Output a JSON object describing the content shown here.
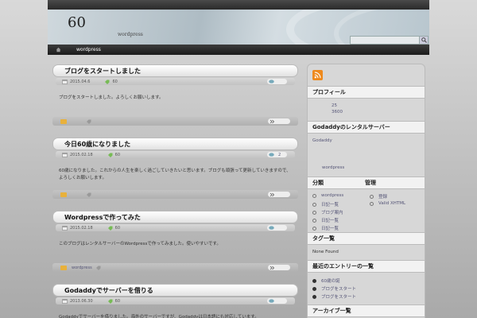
{
  "site": {
    "title": "60",
    "description": "wordpress"
  },
  "nav": {
    "items": [
      "wordpress"
    ]
  },
  "posts": [
    {
      "title": "ブログをスタートしました",
      "date": "2015.04.6",
      "tag": "60",
      "excerpt": "ブログをスタートしました。よろしくお願いします。",
      "comments": "",
      "category": ""
    },
    {
      "title": "今日60歳になりました",
      "date": "2015.02.18",
      "tag": "60",
      "excerpt": "60歳になりました。これからの人生を楽しく過ごしていきたいと思います。ブログも頑張って更新していきますので、よろしくお願いします。",
      "comments": "2",
      "category": ""
    },
    {
      "title": "Wordpressで作ってみた",
      "date": "2015.02.18",
      "tag": "60",
      "excerpt": "このブログはレンタルサーバーのWordpressで作ってみました。使いやすいです。",
      "comments": "",
      "category": "wordpress"
    },
    {
      "title": "Godaddyでサーバーを借りる",
      "date": "2013.06.30",
      "tag": "60",
      "excerpt": "Godaddyでサーバーを借りました。海外のサーバーですが、Godaddyは日本語にも対応しています。",
      "comments": "",
      "category": ""
    }
  ],
  "sidebar": {
    "profile": {
      "title": "プロフィール",
      "line1": "25",
      "line2": "3600"
    },
    "godaddy": {
      "title": "Godaddyのレンタルサーバー",
      "line1": "Godaddy",
      "line2": "wordpress"
    },
    "categories": {
      "title": "分類",
      "items": [
        "wordpress",
        "日記一覧",
        "ブログ案内",
        "日記一覧",
        "日記一覧"
      ]
    },
    "meta": {
      "title": "管理",
      "items": [
        "登録",
        "Valid XHTML"
      ]
    },
    "tags": {
      "title": "タグ一覧",
      "text": "None Found"
    },
    "recent": {
      "title": "最近のエントリーの一覧",
      "items": [
        "60歳の誕",
        "ブログをスタート",
        "ブログをスタート"
      ]
    },
    "archive": {
      "title": "アーカイブ一覧"
    }
  }
}
